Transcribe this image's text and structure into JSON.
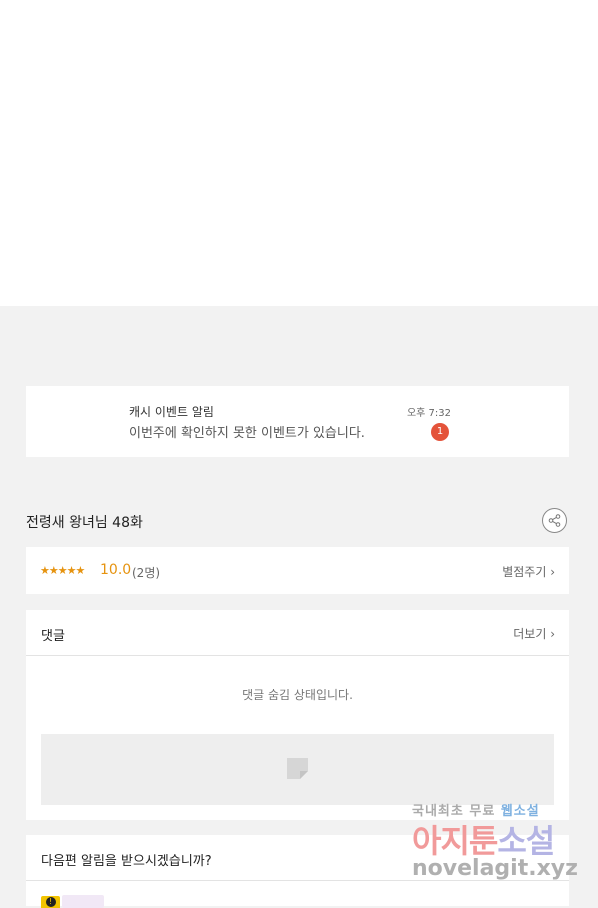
{
  "notice": {
    "title": "캐시 이벤트 알림",
    "message": "이번주에 확인하지 못한 이벤트가 있습니다.",
    "time": "오후 7:32",
    "badge_count": "1",
    "badge_color": "#e4533a"
  },
  "episode": {
    "title": "전령새 왕녀님 48화",
    "share_icon": "share-icon"
  },
  "rating": {
    "stars": "★★★★★",
    "stars_value": 5,
    "score": "10.0",
    "count": "(2명)",
    "rate_link": "별점주기 ›",
    "accent_color": "#e6930f"
  },
  "comments": {
    "heading": "댓글",
    "more_link": "더보기 ›",
    "hidden_message": "댓글 숨김 상태입니다."
  },
  "subscribe": {
    "question": "다음편 알림을 받으시겠습니까?"
  },
  "watermark": {
    "line1_a": "국내최초 무료 ",
    "line1_b": "웹소설",
    "line2_a": "아지툰",
    "line2_b": "소설",
    "line3": "novelagit.xyz"
  }
}
